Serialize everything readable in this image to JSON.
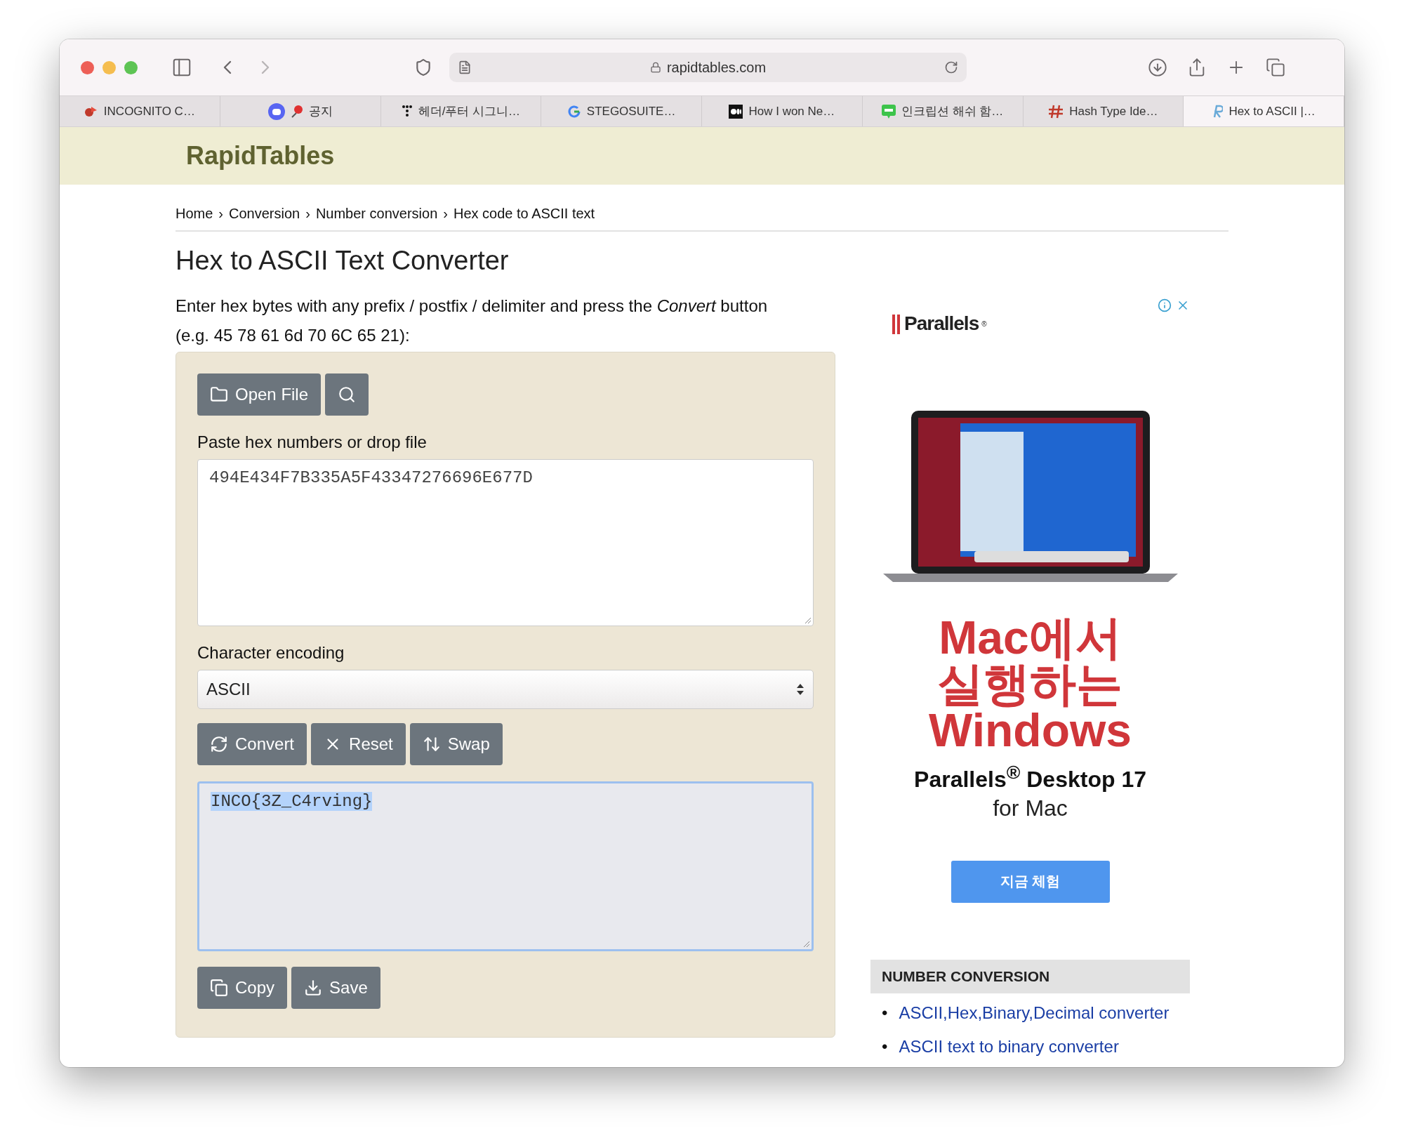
{
  "browser": {
    "url": "rapidtables.com",
    "back_disabled": false,
    "forward_disabled": true,
    "tabs": [
      {
        "kind": "incognito",
        "title": "INCOGNITO C…",
        "selected": false
      },
      {
        "kind": "discord",
        "title": "공지",
        "selected": false
      },
      {
        "kind": "dots",
        "title": "헤더/푸터 시그니…",
        "selected": false
      },
      {
        "kind": "google",
        "title": "STEGOSUITE…",
        "selected": false
      },
      {
        "kind": "medium",
        "title": "How I won Ne…",
        "selected": false
      },
      {
        "kind": "blog",
        "title": "인크립션 해쉬 함…",
        "selected": false
      },
      {
        "kind": "hash",
        "title": "Hash Type Ide…",
        "selected": false
      },
      {
        "kind": "rapid",
        "title": "Hex to ASCII |…",
        "selected": true
      }
    ]
  },
  "site": {
    "logo": "RapidTables"
  },
  "breadcrumb": [
    {
      "label": "Home"
    },
    {
      "separator": "›",
      "label": "Conversion"
    },
    {
      "separator": "›",
      "label": "Number conversion"
    },
    {
      "separator": "›",
      "label": "Hex code to ASCII text"
    }
  ],
  "title": "Hex to ASCII Text Converter",
  "instructions": [
    "Enter hex bytes with any prefix / postfix / delimiter and press the *Convert* button",
    "(e.g. 45 78 61 6d 70 6C 65 21):"
  ],
  "converter": {
    "file_buttons": [
      {
        "kind": "folder",
        "label": "Open File"
      },
      {
        "kind": "search"
      }
    ],
    "input_label": "Paste hex numbers or drop file",
    "input_value": "494E434F7B335A5F43347276696E677D",
    "encoding_label": "Character encoding",
    "encoding_value": "ASCII",
    "action_buttons": [
      {
        "kind": "convert",
        "label": "Convert"
      },
      {
        "kind": "reset",
        "label": "Reset"
      },
      {
        "kind": "swap",
        "label": "Swap"
      }
    ],
    "output_value": "INCO{3Z_C4rving}",
    "output_highlighted": true,
    "output_buttons": [
      {
        "kind": "copy",
        "label": "Copy"
      },
      {
        "kind": "save",
        "label": "Save"
      }
    ]
  },
  "ad": {
    "brand": "Parallels",
    "brand_mark": "®",
    "headline": [
      "Mac에서",
      "실행하는",
      "Windows"
    ],
    "product": "Parallels$^{®}$ Desktop 17",
    "subtitle": "for Mac",
    "cta": "지금 체험"
  },
  "sidebar": {
    "heading": "NUMBER CONVERSION",
    "links": [
      {
        "bullet": "•",
        "label": "ASCII,Hex,Binary,Decimal converter"
      },
      {
        "bullet": "•",
        "label": "ASCII text to binary converter"
      }
    ]
  }
}
